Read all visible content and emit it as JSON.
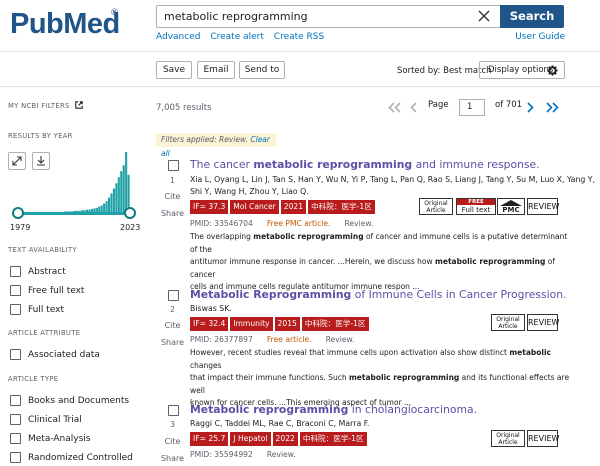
{
  "header": {
    "logo_text": "PubMed",
    "logo_reg": "®",
    "search_value": "metabolic reprogramming",
    "search_label": "Search",
    "links": [
      "Advanced",
      "Create alert",
      "Create RSS"
    ],
    "user_guide": "User Guide"
  },
  "toolbar": {
    "save": "Save",
    "email": "Email",
    "send_to": "Send to",
    "sorted_by": "Sorted by: Best match",
    "display_options": "Display options"
  },
  "sidebar": {
    "my_filters": "MY NCBI FILTERS",
    "results_by_year": "RESULTS BY YEAR",
    "year_start": "1979",
    "year_end": "2023",
    "histogram": [
      0,
      0,
      0,
      0,
      0,
      0,
      0,
      0,
      0,
      0,
      0,
      0,
      0,
      0,
      0,
      0,
      0,
      0,
      1,
      1,
      1,
      1,
      2,
      2,
      2,
      3,
      3,
      4,
      4,
      5,
      6,
      7,
      9,
      11,
      14,
      18,
      24,
      31,
      39,
      48,
      58,
      68,
      78,
      100,
      62
    ],
    "text_availability": "TEXT AVAILABILITY",
    "text_items": [
      "Abstract",
      "Free full text",
      "Full text"
    ],
    "article_attribute": "ARTICLE ATTRIBUTE",
    "attr_items": [
      "Associated data"
    ],
    "article_type": "ARTICLE TYPE",
    "type_items": [
      "Books and Documents",
      "Clinical Trial",
      "Meta-Analysis",
      "Randomized Controlled"
    ]
  },
  "results": {
    "count": "7,005 results",
    "page_label": "Page",
    "page_value": "1",
    "page_of": "of 701",
    "filters_applied": "Filters applied: Review.",
    "clear_all": "Clear all"
  },
  "articles": [
    {
      "num": "1",
      "title_pre": "The cancer ",
      "title_bold": "metabolic reprogramming",
      "title_post": " and immune response.",
      "authors1": "Xia L, Oyang L, Lin J, Tan S, Han Y, Wu N, Yi P, Tang L, Pan Q, Rao S, Liang J, Tang Y, Su M, Luo X, Yang Y,",
      "authors2": "Shi Y, Wang H, Zhou Y, Liao Q.",
      "tags": [
        "IF= 37.3",
        "Mol Cancer",
        "2021",
        "中科院：医学-1区"
      ],
      "pmid": "PMID: 33546704",
      "free": "Free PMC article.",
      "rev": "Review.",
      "snip1_pre": "The overlapping ",
      "snip1_b": "metabolic reprogramming",
      "snip1_post": " of cancer and immune cells is a putative determinant of the",
      "snip2": "antitumor immune response in cancer. ...Herein, we discuss how ",
      "snip2_b": "metabolic reprogramming",
      "snip2_post": " of cancer",
      "snip3": "cells and immune cells regulate antitumor immune respon ...",
      "badges": {
        "original": "Original Article",
        "free_top": "FREE",
        "free_bot": "Full text",
        "pmc": "PMC",
        "review": "REVIEW"
      }
    },
    {
      "num": "2",
      "title_bold": "Metabolic Reprogramming",
      "title_post": " of Immune Cells in Cancer Progression.",
      "authors1": "Biswas SK.",
      "tags": [
        "IF= 32.4",
        "Immunity",
        "2015",
        "中科院：医学-1区"
      ],
      "pmid": "PMID: 26377897",
      "free": "Free article.",
      "rev": "Review.",
      "snip1": "However, recent studies reveal that immune cells upon activation also show distinct ",
      "snip1_b": "metabolic",
      "snip1_post": " changes",
      "snip2": "that impact their immune functions. Such ",
      "snip2_b": "metabolic reprogramming",
      "snip2_post": " and its functional effects are well",
      "snip3": "known for cancer cells. ...This emerging aspect of tumor ...",
      "badges": {
        "original": "Original Article",
        "review": "REVIEW"
      }
    },
    {
      "num": "3",
      "title_bold": "Metabolic reprogramming",
      "title_post": " in cholangiocarcinoma.",
      "authors1": "Raggi C, Taddei ML, Rae C, Braconi C, Marra F.",
      "tags": [
        "IF= 25.7",
        "J Hepatol",
        "2022",
        "中科院：医学-1区"
      ],
      "pmid": "PMID: 35594992",
      "rev": "Review.",
      "badges": {
        "original": "Original Article",
        "review": "REVIEW"
      }
    }
  ],
  "actions": {
    "cite": "Cite",
    "share": "Share"
  },
  "colors": {
    "brand": "#20558a",
    "link": "#0071bc",
    "title": "#5b4fa6",
    "tag": "#b81c1c",
    "histogram": "#20a1a8"
  }
}
